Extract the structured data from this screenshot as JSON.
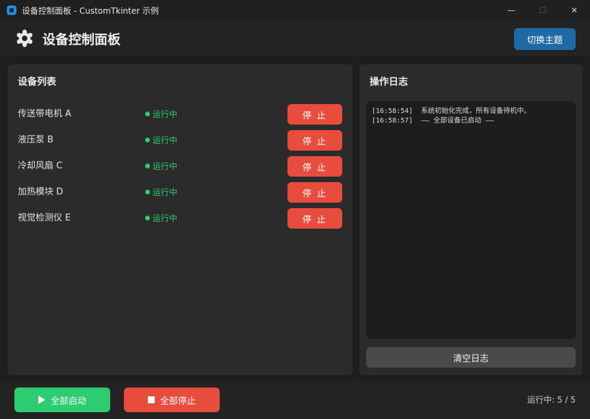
{
  "window": {
    "title": "设备控制面板 - CustomTkinter 示例",
    "minimize": "—",
    "maximize": "☐",
    "close": "✕"
  },
  "header": {
    "title": "设备控制面板",
    "theme_button": "切换主题"
  },
  "devices": {
    "title": "设备列表",
    "items": [
      {
        "name": "传送带电机 A",
        "status": "运行中",
        "action": "停 止"
      },
      {
        "name": "液压泵 B",
        "status": "运行中",
        "action": "停 止"
      },
      {
        "name": "冷却风扇 C",
        "status": "运行中",
        "action": "停 止"
      },
      {
        "name": "加热模块 D",
        "status": "运行中",
        "action": "停 止"
      },
      {
        "name": "视觉检测仪 E",
        "status": "运行中",
        "action": "停 止"
      }
    ]
  },
  "log": {
    "title": "操作日志",
    "lines": [
      "[16:58:54]  系统初始化完成，所有设备待机中。",
      "[16:58:57]  —— 全部设备已启动 ——"
    ],
    "clear_button": "清空日志"
  },
  "footer": {
    "start_all": "全部启动",
    "stop_all": "全部停止",
    "run_count": "运行中: 5 / 5"
  },
  "colors": {
    "accent": "#1f6aa5",
    "running": "#2ecc71",
    "stop": "#e74c3c"
  }
}
